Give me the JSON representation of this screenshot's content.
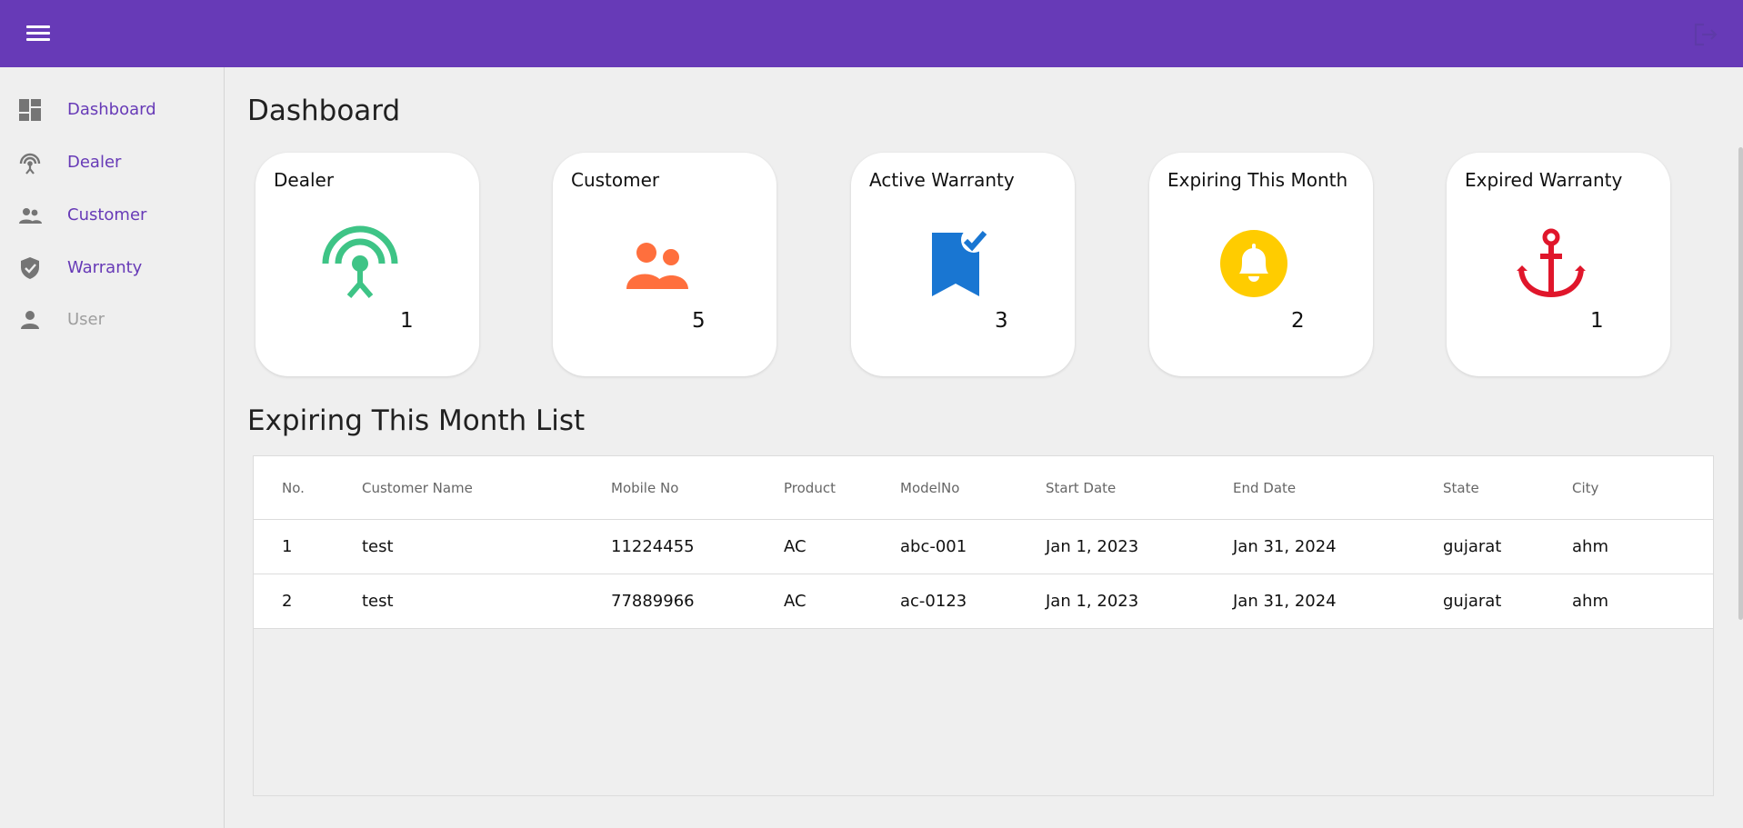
{
  "colors": {
    "brand": "#673ab7",
    "dealer": "#3ec486",
    "customer": "#ff6f3d",
    "active": "#1976d2",
    "expiring": "#ffcc00",
    "expired": "#e0162b"
  },
  "sidebar": {
    "items": [
      {
        "label": "Dashboard",
        "icon": "dashboard-icon"
      },
      {
        "label": "Dealer",
        "icon": "antenna-icon"
      },
      {
        "label": "Customer",
        "icon": "people-icon"
      },
      {
        "label": "Warranty",
        "icon": "shield-check-icon"
      },
      {
        "label": "User",
        "icon": "person-icon"
      }
    ]
  },
  "main": {
    "title": "Dashboard",
    "cards": [
      {
        "title": "Dealer",
        "count": "1",
        "icon": "antenna-icon"
      },
      {
        "title": "Customer",
        "count": "5",
        "icon": "people-icon"
      },
      {
        "title": "Active Warranty",
        "count": "3",
        "icon": "bookmark-check-icon"
      },
      {
        "title": "Expiring This Month",
        "count": "2",
        "icon": "bell-icon"
      },
      {
        "title": "Expired Warranty",
        "count": "1",
        "icon": "anchor-icon"
      }
    ],
    "list_title": "Expiring This Month List",
    "table": {
      "headers": [
        "No.",
        "Customer Name",
        "Mobile No",
        "Product",
        "ModelNo",
        "Start Date",
        "End Date",
        "State",
        "City"
      ],
      "rows": [
        [
          "1",
          "test",
          "11224455",
          "AC",
          "abc-001",
          "Jan 1, 2023",
          "Jan 31, 2024",
          "gujarat",
          "ahm"
        ],
        [
          "2",
          "test",
          "77889966",
          "AC",
          "ac-0123",
          "Jan 1, 2023",
          "Jan 31, 2024",
          "gujarat",
          "ahm"
        ]
      ]
    }
  }
}
